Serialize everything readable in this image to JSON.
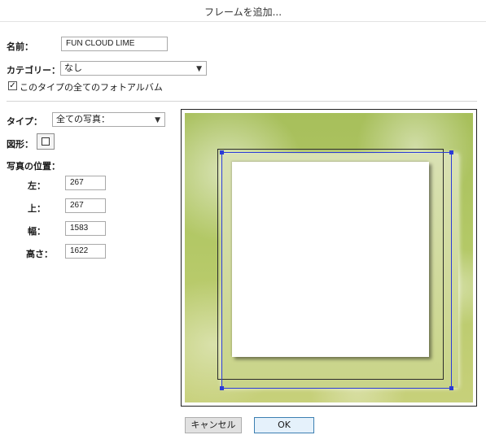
{
  "dialog": {
    "title": "フレームを追加..."
  },
  "form": {
    "name_label": "名前：",
    "name_value": "FUN CLOUD LIME",
    "category_label": "カテゴリー：",
    "category_value": "なし",
    "apply_all_checked": true,
    "apply_all_label": "このタイプの全てのフォトアルバム",
    "type_label": "タイプ：",
    "type_value": "全ての写真：",
    "shape_label": "図形：",
    "position_heading": "写真の位置：",
    "left_label": "左：",
    "left_value": "267",
    "top_label": "上：",
    "top_value": "267",
    "width_label": "幅：",
    "width_value": "1583",
    "height_label": "高さ：",
    "height_value": "1622"
  },
  "buttons": {
    "cancel": "キャンセル",
    "ok": "OK"
  },
  "icons": {
    "checkbox_mark": "✓",
    "dropdown": "chevron-down-icon",
    "shape": "rectangle-shape-icon"
  },
  "colors": {
    "selection": "#2b3bd6",
    "preview_background": "#b3c866"
  }
}
